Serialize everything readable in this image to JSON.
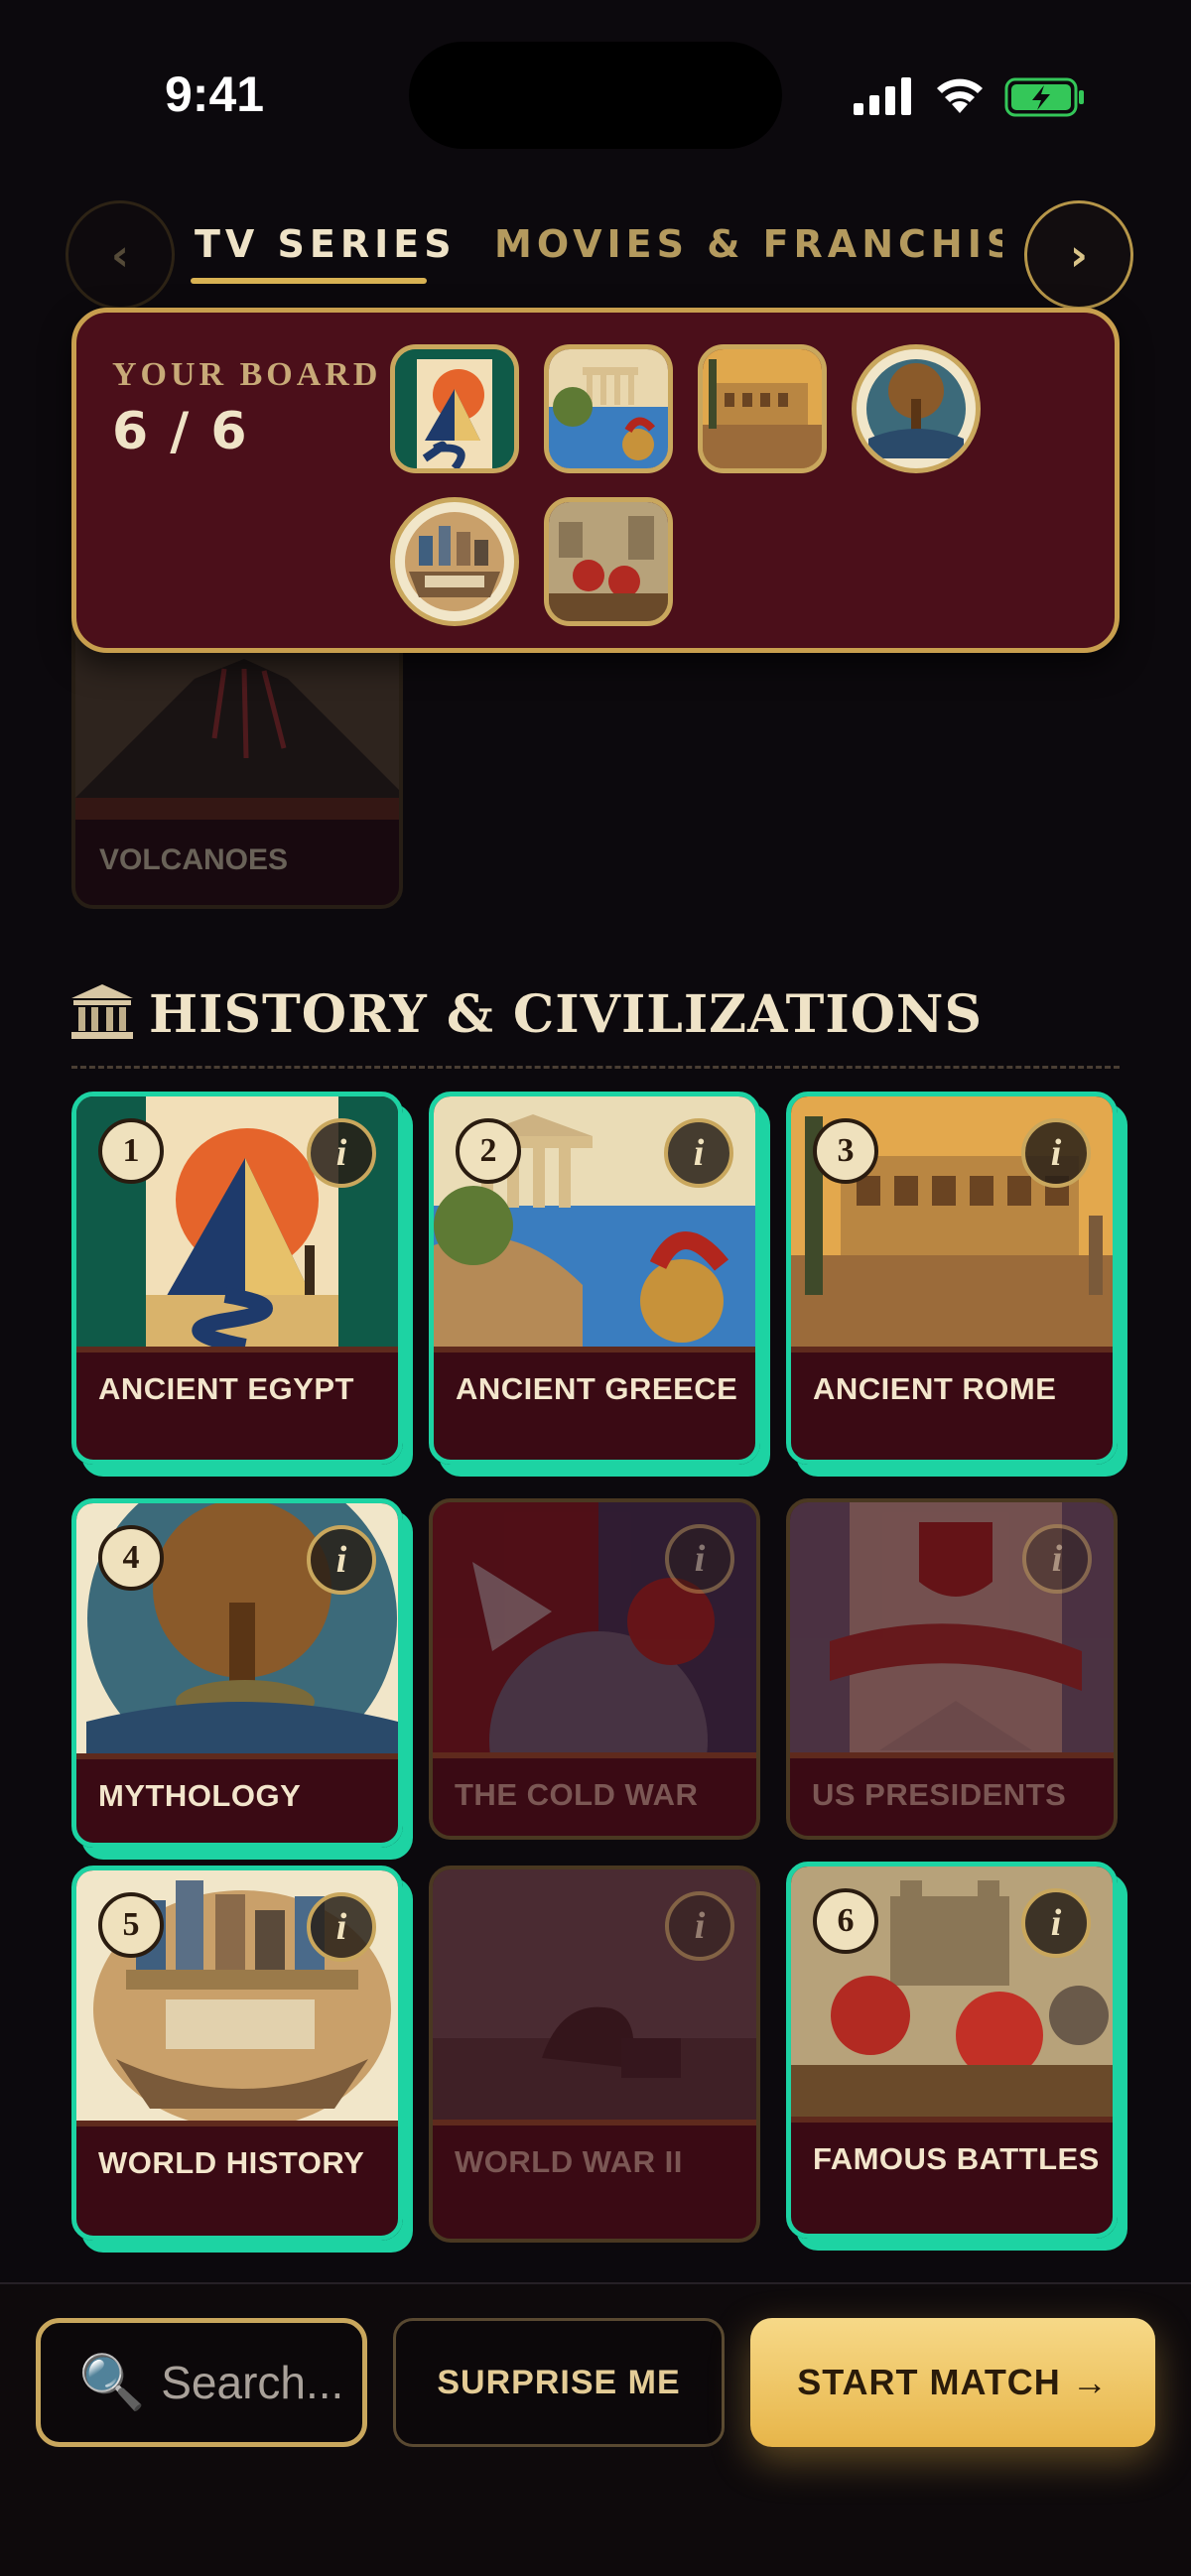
{
  "status_bar": {
    "time": "9:41"
  },
  "tabs": {
    "items": [
      {
        "label": "TV SERIES",
        "active": true
      },
      {
        "label": "MOVIES & FRANCHISES",
        "active": false
      }
    ],
    "prev_icon": "chevron-left-icon",
    "next_icon": "chevron-right-icon"
  },
  "board": {
    "label": "YOUR BOARD",
    "count": "6 / 6",
    "selected": 6,
    "max": 6
  },
  "faded_card": {
    "label": "VOLCANOES"
  },
  "section": {
    "icon": "temple-icon",
    "title": "HISTORY & CIVILIZATIONS"
  },
  "cards": [
    {
      "label": "ANCIENT EGYPT",
      "number": "1",
      "selected": true
    },
    {
      "label": "ANCIENT GREECE",
      "number": "2",
      "selected": true
    },
    {
      "label": "ANCIENT ROME",
      "number": "3",
      "selected": true
    },
    {
      "label": "MYTHOLOGY",
      "number": "4",
      "selected": true
    },
    {
      "label": "THE COLD WAR",
      "number": "",
      "selected": false
    },
    {
      "label": "US PRESIDENTS",
      "number": "",
      "selected": false
    },
    {
      "label": "WORLD HISTORY",
      "number": "5",
      "selected": true
    },
    {
      "label": "WORLD WAR II",
      "number": "",
      "selected": false
    },
    {
      "label": "FAMOUS BATTLES",
      "number": "6",
      "selected": true
    }
  ],
  "info_label": "i",
  "bottom": {
    "search": {
      "icon": "search-icon",
      "placeholder": "Search..."
    },
    "surprise_label": "SURPRISE ME",
    "start_label": "START MATCH →"
  },
  "colors": {
    "accent_gold": "#d8b253",
    "selected_teal": "#1dd3a3",
    "board_bg": "#4b0f1a"
  }
}
